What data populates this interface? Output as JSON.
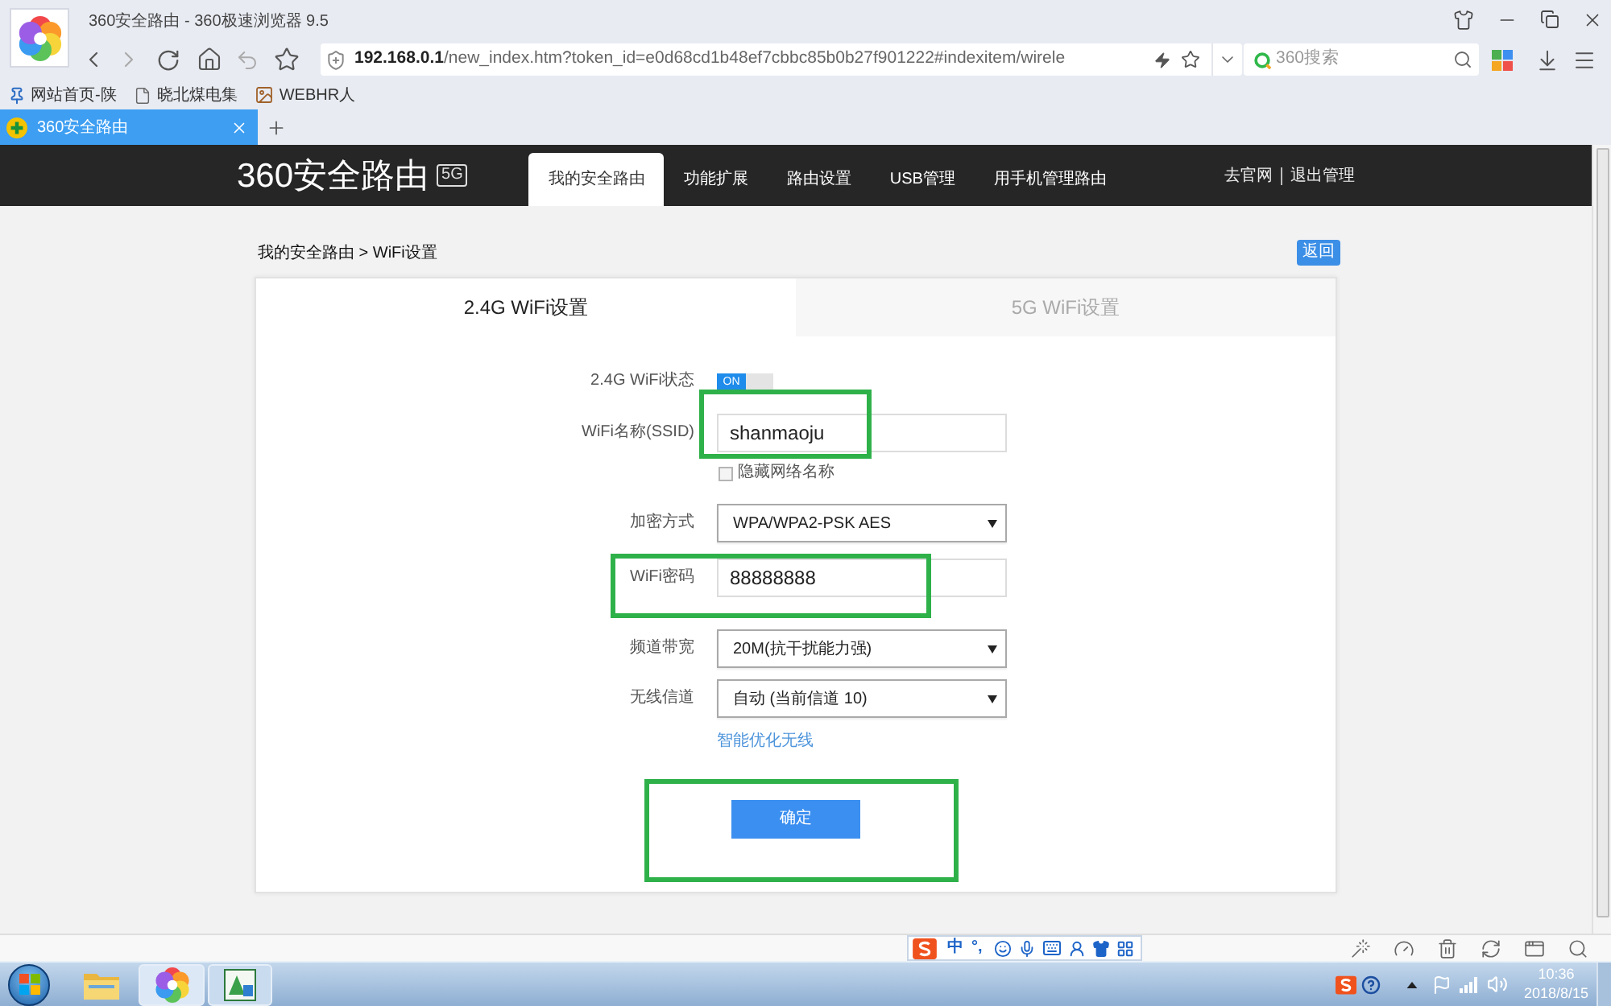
{
  "window": {
    "title": "360安全路由 - 360极速浏览器 9.5"
  },
  "address_bar": {
    "host": "192.168.0.1",
    "path": "/new_index.htm?token_id=e0d68cd1b48ef7cbbc85b0b27f901222#indexitem/wirele"
  },
  "search": {
    "placeholder": "360搜索"
  },
  "bookmarks": [
    {
      "kind": "pin",
      "label": "网站首页-陕"
    },
    {
      "kind": "page",
      "label": "晓北煤电集"
    },
    {
      "kind": "image",
      "label": "WEBHR人"
    }
  ],
  "tabs": [
    {
      "label": "360安全路由",
      "selected": true
    }
  ],
  "router": {
    "logo": "360安全路由",
    "logo_badge": "5G",
    "nav": [
      {
        "label": "我的安全路由",
        "selected": true
      },
      {
        "label": "功能扩展",
        "selected": false
      },
      {
        "label": "路由设置",
        "selected": false
      },
      {
        "label": "USB管理",
        "selected": false
      },
      {
        "label": "用手机管理路由",
        "selected": false
      }
    ],
    "links": [
      "去官网",
      "退出管理"
    ]
  },
  "breadcrumb": "我的安全路由 > WiFi设置",
  "back_button": "返回",
  "settings": {
    "tabs": [
      {
        "label": "2.4G WiFi设置",
        "selected": true
      },
      {
        "label": "5G WiFi设置",
        "selected": false
      }
    ],
    "fields": [
      {
        "kind": "toggle",
        "label": "2.4G WiFi状态",
        "on": true,
        "text": "ON"
      },
      {
        "kind": "input",
        "label": "WiFi名称(SSID)",
        "value": "shanmaoju"
      },
      {
        "kind": "checkbox",
        "label": "隐藏网络名称",
        "checked": false
      },
      {
        "kind": "select",
        "label": "加密方式",
        "value": "WPA/WPA2-PSK AES"
      },
      {
        "kind": "input",
        "label": "WiFi密码",
        "value": "88888888"
      },
      {
        "kind": "select",
        "label": "频道带宽",
        "value": "20M(抗干扰能力强)"
      },
      {
        "kind": "select",
        "label": "无线信道",
        "value": "自动 (当前信道 10)"
      },
      {
        "kind": "link",
        "label": "智能优化无线"
      }
    ],
    "submit": "确定"
  },
  "ime_toolbar": [
    "中",
    "°,"
  ],
  "taskbar": {
    "time": "10:36",
    "date": "2018/8/15"
  }
}
